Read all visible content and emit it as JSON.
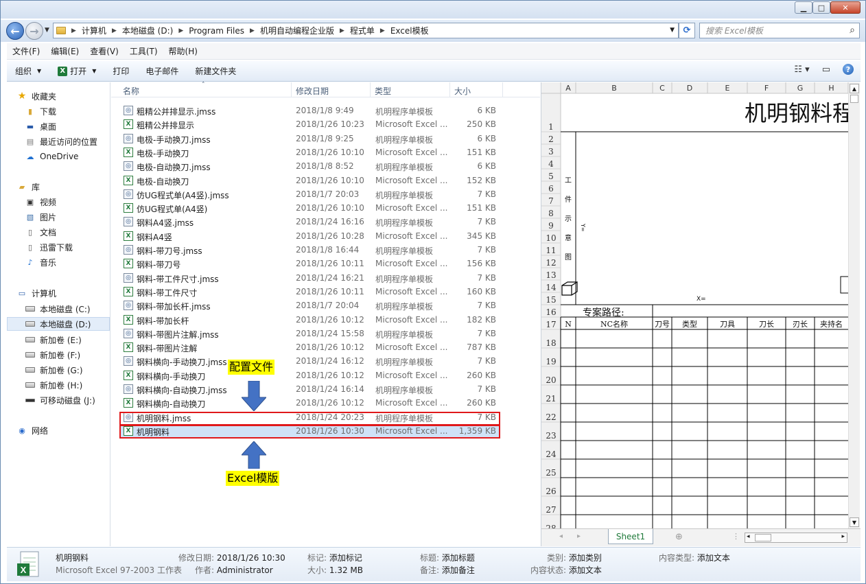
{
  "window": {
    "controls": {
      "minimize": "▁",
      "maximize": "□",
      "close": "✕"
    }
  },
  "address": {
    "crumbs": [
      "计算机",
      "本地磁盘 (D:)",
      "Program Files",
      "机明自动编程企业版",
      "程式单",
      "Excel模板"
    ],
    "search_placeholder": "搜索 Excel模板"
  },
  "menu": [
    "文件(F)",
    "编辑(E)",
    "查看(V)",
    "工具(T)",
    "帮助(H)"
  ],
  "toolbar": {
    "organize": "组织",
    "open": "打开",
    "print": "打印",
    "email": "电子邮件",
    "new_folder": "新建文件夹"
  },
  "nav": {
    "favorites": "收藏夹",
    "downloads": "下载",
    "desktop": "桌面",
    "recent": "最近访问的位置",
    "onedrive": "OneDrive",
    "library": "库",
    "videos": "视频",
    "pictures": "图片",
    "documents": "文档",
    "thunder": "迅雷下载",
    "music": "音乐",
    "computer": "计算机",
    "drive_c": "本地磁盘 (C:)",
    "drive_d": "本地磁盘 (D:)",
    "drive_e": "新加卷 (E:)",
    "drive_f": "新加卷 (F:)",
    "drive_g": "新加卷 (G:)",
    "drive_h": "新加卷 (H:)",
    "drive_j": "可移动磁盘 (J:)",
    "network": "网络"
  },
  "columns": {
    "name": "名称",
    "date": "修改日期",
    "type": "类型",
    "size": "大小"
  },
  "files": [
    {
      "name": "粗精公并排显示.jmss",
      "date": "2018/1/8 9:49",
      "type": "机明程序单模板",
      "size": "6 KB",
      "kind": "jmss"
    },
    {
      "name": "粗精公并排显示",
      "date": "2018/1/26 10:23",
      "type": "Microsoft Excel ...",
      "size": "250 KB",
      "kind": "xls"
    },
    {
      "name": "电极-手动换刀.jmss",
      "date": "2018/1/8 9:25",
      "type": "机明程序单模板",
      "size": "6 KB",
      "kind": "jmss"
    },
    {
      "name": "电极-手动换刀",
      "date": "2018/1/26 10:10",
      "type": "Microsoft Excel ...",
      "size": "151 KB",
      "kind": "xls"
    },
    {
      "name": "电极-自动换刀.jmss",
      "date": "2018/1/8 8:52",
      "type": "机明程序单模板",
      "size": "6 KB",
      "kind": "jmss"
    },
    {
      "name": "电极-自动换刀",
      "date": "2018/1/26 10:10",
      "type": "Microsoft Excel ...",
      "size": "152 KB",
      "kind": "xls"
    },
    {
      "name": "仿UG程式单(A4竖).jmss",
      "date": "2018/1/7 20:03",
      "type": "机明程序单模板",
      "size": "7 KB",
      "kind": "jmss"
    },
    {
      "name": "仿UG程式单(A4竖)",
      "date": "2018/1/26 10:10",
      "type": "Microsoft Excel ...",
      "size": "151 KB",
      "kind": "xls"
    },
    {
      "name": "钢料A4竖.jmss",
      "date": "2018/1/24 16:16",
      "type": "机明程序单模板",
      "size": "7 KB",
      "kind": "jmss"
    },
    {
      "name": "钢料A4竖",
      "date": "2018/1/26 10:28",
      "type": "Microsoft Excel ...",
      "size": "345 KB",
      "kind": "xls"
    },
    {
      "name": "钢料-带刀号.jmss",
      "date": "2018/1/8 16:44",
      "type": "机明程序单模板",
      "size": "7 KB",
      "kind": "jmss"
    },
    {
      "name": "钢料-带刀号",
      "date": "2018/1/26 10:11",
      "type": "Microsoft Excel ...",
      "size": "156 KB",
      "kind": "xls"
    },
    {
      "name": "钢料-带工件尺寸.jmss",
      "date": "2018/1/24 16:21",
      "type": "机明程序单模板",
      "size": "7 KB",
      "kind": "jmss"
    },
    {
      "name": "钢料-带工件尺寸",
      "date": "2018/1/26 10:11",
      "type": "Microsoft Excel ...",
      "size": "160 KB",
      "kind": "xls"
    },
    {
      "name": "钢料-带加长杆.jmss",
      "date": "2018/1/7 20:04",
      "type": "机明程序单模板",
      "size": "7 KB",
      "kind": "jmss"
    },
    {
      "name": "钢料-带加长杆",
      "date": "2018/1/26 10:12",
      "type": "Microsoft Excel ...",
      "size": "182 KB",
      "kind": "xls"
    },
    {
      "name": "钢料-带图片注解.jmss",
      "date": "2018/1/24 15:58",
      "type": "机明程序单模板",
      "size": "7 KB",
      "kind": "jmss"
    },
    {
      "name": "钢料-带图片注解",
      "date": "2018/1/26 10:12",
      "type": "Microsoft Excel ...",
      "size": "787 KB",
      "kind": "xls"
    },
    {
      "name": "钢料横向-手动换刀.jmss",
      "date": "2018/1/24 16:12",
      "type": "机明程序单模板",
      "size": "7 KB",
      "kind": "jmss"
    },
    {
      "name": "钢料横向-手动换刀",
      "date": "2018/1/26 10:12",
      "type": "Microsoft Excel ...",
      "size": "260 KB",
      "kind": "xls"
    },
    {
      "name": "钢料横向-自动换刀.jmss",
      "date": "2018/1/24 16:14",
      "type": "机明程序单模板",
      "size": "7 KB",
      "kind": "jmss"
    },
    {
      "name": "钢料横向-自动换刀",
      "date": "2018/1/26 10:12",
      "type": "Microsoft Excel ...",
      "size": "260 KB",
      "kind": "xls"
    },
    {
      "name": "机明钢料.jmss",
      "date": "2018/1/24 20:23",
      "type": "机明程序单模板",
      "size": "7 KB",
      "kind": "jmss"
    },
    {
      "name": "机明钢料",
      "date": "2018/1/26 10:30",
      "type": "Microsoft Excel ...",
      "size": "1,359 KB",
      "kind": "xls"
    }
  ],
  "annotations": {
    "config": "配置文件",
    "excel": "Excel模版"
  },
  "preview": {
    "col_letters": [
      "A",
      "B",
      "C",
      "D",
      "E",
      "F",
      "G",
      "H"
    ],
    "row_numbers": [
      "1",
      "2",
      "3",
      "4",
      "5",
      "6",
      "7",
      "8",
      "9",
      "10",
      "11",
      "12",
      "13",
      "14",
      "15",
      "16",
      "17",
      "18",
      "19",
      "20",
      "21",
      "22",
      "23",
      "24",
      "25",
      "26",
      "27",
      "28"
    ],
    "title": "机明钢料程",
    "vertical_label": [
      "工",
      "件",
      "示",
      "意",
      "图"
    ],
    "y_label": "Y=",
    "x_label": "X=",
    "path_label": "专案路径:",
    "table_headers": [
      "N",
      "NC名称",
      "刀号",
      "类型",
      "刀具",
      "刀长",
      "刃长",
      "夹持名"
    ],
    "sheet_tab": "Sheet1"
  },
  "details": {
    "filename": "机明钢料",
    "filetype": "Microsoft Excel 97-2003 工作表",
    "mod_label": "修改日期:",
    "mod_value": "2018/1/26 10:30",
    "author_label": "作者:",
    "author_value": "Administrator",
    "tag_label": "标记:",
    "tag_value": "添加标记",
    "size_label": "大小:",
    "size_value": "1.32 MB",
    "title_label": "标题:",
    "title_value": "添加标题",
    "note_label": "备注:",
    "note_value": "添加备注",
    "cat_label": "类别:",
    "cat_value": "添加类别",
    "status_label": "内容状态:",
    "status_value": "添加文本",
    "ctype_label": "内容类型:",
    "ctype_value": "添加文本"
  }
}
